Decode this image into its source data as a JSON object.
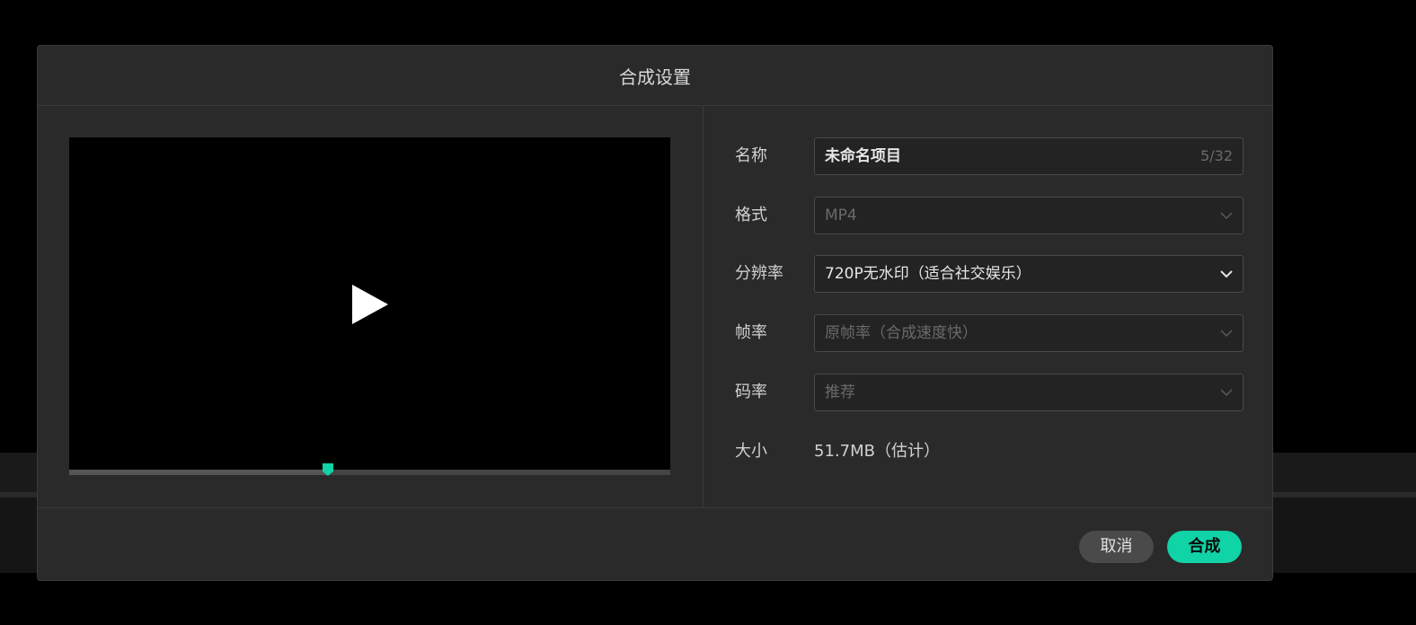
{
  "dialog": {
    "title": "合成设置"
  },
  "preview": {
    "play_icon": "play-icon",
    "progress_fraction": 0.43,
    "accent_color": "#10d3a6"
  },
  "form": {
    "name": {
      "label": "名称",
      "value": "未命名项目",
      "counter": "5/32"
    },
    "format": {
      "label": "格式",
      "value": "MP4",
      "disabled": true
    },
    "resolution": {
      "label": "分辨率",
      "value": "720P无水印（适合社交娱乐）",
      "disabled": false
    },
    "framerate": {
      "label": "帧率",
      "value": "原帧率（合成速度快）",
      "disabled": true
    },
    "bitrate": {
      "label": "码率",
      "value": "推荐",
      "disabled": true
    },
    "size": {
      "label": "大小",
      "value": "51.7MB（估计）"
    }
  },
  "footer": {
    "cancel_label": "取消",
    "ok_label": "合成"
  }
}
